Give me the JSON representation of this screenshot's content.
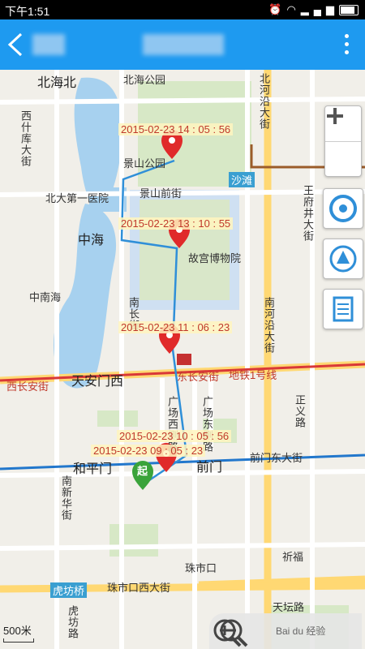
{
  "status": {
    "time": "下午1:51"
  },
  "map": {
    "labels": {
      "beihaibei": "北海北",
      "beihai_park": "北海公园",
      "beiheyan": "北河沿大街",
      "xishiku": "西什库大街",
      "jingshan_park": "景山公园",
      "shatan": "沙滩",
      "hospital": "北大第一医院",
      "jingshan_front": "景山前街",
      "wangfujing": "王府井大街",
      "zhonghai": "中海",
      "palace": "故宫博物院",
      "zhongnanhai": "中南海",
      "nanchang": "南长街",
      "nanheyan": "南河沿大街",
      "tiananmen_w": "天安门西",
      "xichangan": "西长安街",
      "dongchangan": "东长安街",
      "metro1": "地铁1号线",
      "guangchang_w": "广场西侧路",
      "guangchang_e": "广场东侧路",
      "zhengyi": "正义路",
      "hepingmen": "和平门",
      "qianmen": "前门",
      "qianmen_e": "前门东大街",
      "nanxinhua": "南新华街",
      "hufangqiao": "虎坊桥",
      "zhushikou": "珠市口西大街",
      "zhushikou_short": "珠市口",
      "tiantan": "天坛路",
      "hufang_road": "虎坊路",
      "qiwan": "祈福"
    },
    "timestamps": {
      "t1": "2015-02-23 14 : 05 : 56",
      "t2": "2015-02-23 13 : 10 : 55",
      "t3": "2015-02-23 11 : 06 : 23",
      "t4": "2015-02-23 10 : 05 : 56",
      "t5": "2015-02-23 09 : 05 : 23"
    },
    "start_marker": "起",
    "scale": "500米",
    "watermark": "Bai du 经验"
  },
  "colors": {
    "appbar": "#1e9af0",
    "route": "#2f8fd8",
    "pin": "#e02a2a",
    "start": "#3aa33a"
  }
}
